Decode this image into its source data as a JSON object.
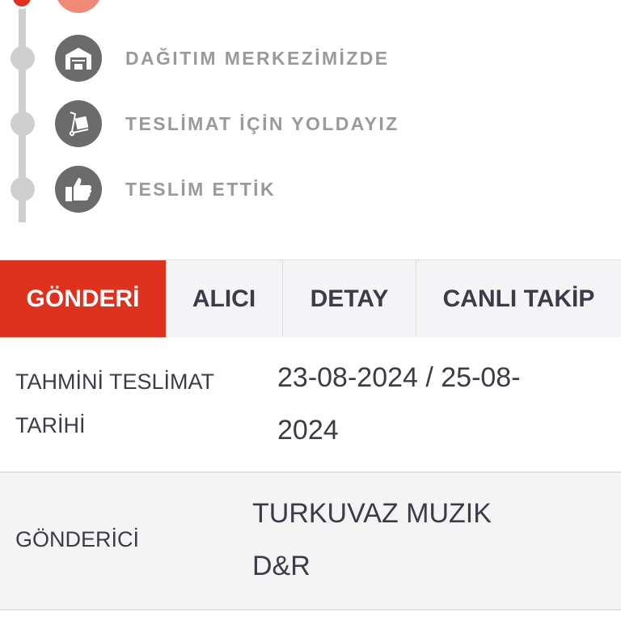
{
  "timeline": {
    "steps": [
      {
        "label": "DAĞITIM MERKEZİMİZDE",
        "icon": "warehouse-icon",
        "state": "pending"
      },
      {
        "label": "TESLİMAT İÇİN YOLDAYIZ",
        "icon": "hand-truck-icon",
        "state": "pending"
      },
      {
        "label": "TESLİM ETTİK",
        "icon": "thumbs-up-icon",
        "state": "pending"
      }
    ],
    "colors": {
      "active": "#e0301e",
      "inactive": "#cfcfcf",
      "icon_bg": "#6b6b6b"
    }
  },
  "tabs": [
    {
      "label": "GÖNDERİ",
      "active": true
    },
    {
      "label": "ALICI",
      "active": false
    },
    {
      "label": "DETAY",
      "active": false
    },
    {
      "label": "CANLI TAKİP",
      "active": false
    }
  ],
  "details": {
    "estimated_delivery": {
      "label_line1": "TAHMİNİ TESLİMAT",
      "label_line2": "TARİHİ",
      "value_line1": "23-08-2024 / 25-08-",
      "value_line2": "2024"
    },
    "sender": {
      "label": "GÖNDERİCİ",
      "value_line1": "TURKUVAZ MUZIK",
      "value_line2": "D&R"
    }
  },
  "colors": {
    "accent": "#e0301e",
    "text": "#3c3c48",
    "muted": "#9a9a9a"
  }
}
